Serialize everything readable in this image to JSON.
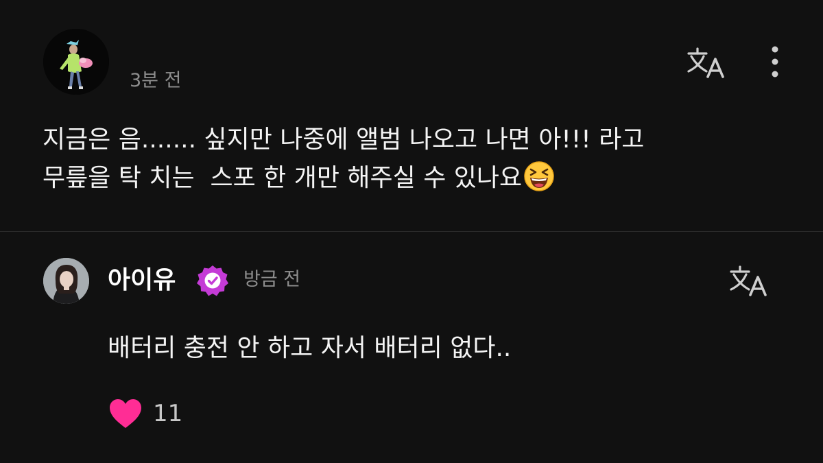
{
  "comment": {
    "time": "3분 전",
    "text_line1": "지금은 음....... 싶지만 나중에 앨범 나오고 나면 아!!! 라고",
    "text_line2": "무릎을 탁 치는  스포 한 개만 해주실 수 있나요",
    "emoji": "laughing-face-emoji",
    "icons": [
      "translate-icon",
      "more-vertical-icon"
    ]
  },
  "reply": {
    "author": "아이유",
    "verified": true,
    "time": "방금 전",
    "text": "배터리 충전 안 하고 자서 배터리 없다..",
    "likes": "11",
    "icons": [
      "verified-badge-icon",
      "translate-icon",
      "heart-icon"
    ]
  },
  "colors": {
    "background": "#111111",
    "text": "#f4f4f4",
    "muted": "#8e8e8e",
    "verified": "#c43bd6",
    "heart": "#ff2d95"
  }
}
